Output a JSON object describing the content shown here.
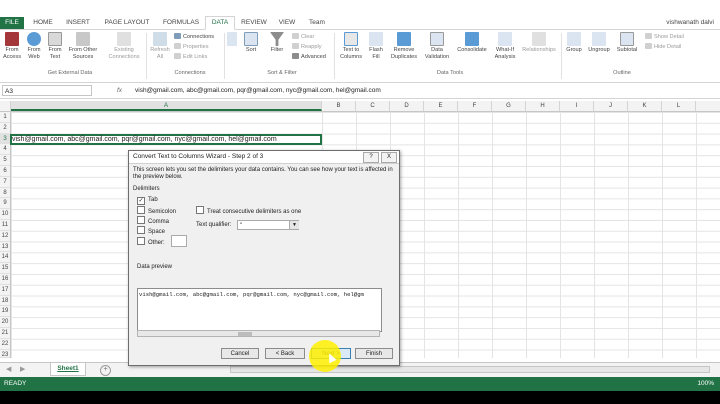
{
  "ribbon_tabs": [
    "FILE",
    "HOME",
    "INSERT",
    "PAGE LAYOUT",
    "FORMULAS",
    "DATA",
    "REVIEW",
    "VIEW",
    "Team"
  ],
  "active_tab": "DATA",
  "user_name": "vishwanath dalvi",
  "accent_color": "#217346",
  "get_external_data": {
    "group_label": "Get External Data",
    "buttons": [
      "From Access",
      "From Web",
      "From Text",
      "From Other Sources",
      "Existing Connections"
    ]
  },
  "connections": {
    "group_label": "Connections",
    "refresh_all": "Refresh All",
    "items": [
      "Connections",
      "Properties",
      "Edit Links"
    ]
  },
  "sort_filter": {
    "group_label": "Sort & Filter",
    "sort": "Sort",
    "filter": "Filter",
    "items": [
      "Clear",
      "Reapply",
      "Advanced"
    ]
  },
  "data_tools": {
    "group_label": "Data Tools",
    "buttons": [
      "Text to Columns",
      "Flash Fill",
      "Remove Duplicates",
      "Data Validation",
      "Consolidate",
      "What-If Analysis",
      "Relationships"
    ]
  },
  "outline": {
    "group_label": "Outline",
    "buttons": [
      "Group",
      "Ungroup",
      "Subtotal"
    ],
    "items": [
      "Show Detail",
      "Hide Detail"
    ]
  },
  "name_box": "A3",
  "fx_label": "fx",
  "formula_value": "vish@gmail.com, abc@gmail.com, pqr@gmail.com, nyc@gmail.com, hel@gmail.com",
  "columns": [
    "A",
    "B",
    "C",
    "D",
    "E",
    "F",
    "G",
    "H",
    "I",
    "J",
    "K",
    "L"
  ],
  "rows": [
    "1",
    "2",
    "3",
    "4",
    "5",
    "6",
    "7",
    "8",
    "9",
    "10",
    "11",
    "12",
    "13",
    "14",
    "15",
    "16",
    "17",
    "18",
    "19",
    "20",
    "21",
    "22",
    "23"
  ],
  "cell_a3": "vish@gmail.com, abc@gmail.com, pqr@gmail.com, nyc@gmail.com, hel@gmail.com",
  "sheet_tab": "Sheet1",
  "add_sheet": "+",
  "status_text": "READY",
  "zoom_text": "100%",
  "dialog": {
    "title": "Convert Text to Columns Wizard - Step 2 of 3",
    "help": "?",
    "close": "X",
    "description": "This screen lets you set the delimiters your data contains. You can see how your text is affected in the preview below.",
    "delimiters_label": "Delimiters",
    "options": [
      {
        "label": "Tab",
        "checked": true
      },
      {
        "label": "Semicolon",
        "checked": false
      },
      {
        "label": "Comma",
        "checked": false
      },
      {
        "label": "Space",
        "checked": false
      },
      {
        "label": "Other:",
        "checked": false
      }
    ],
    "consecutive_label": "Treat consecutive delimiters as one",
    "qualifier_label": "Text qualifier:",
    "qualifier_value": "\"",
    "preview_label": "Data preview",
    "preview_text": "vish@gmail.com, abc@gmail.com, pqr@gmail.com, nyc@gmail.com, hel@gm",
    "buttons": [
      "Cancel",
      "< Back",
      "Next >",
      "Finish"
    ]
  }
}
